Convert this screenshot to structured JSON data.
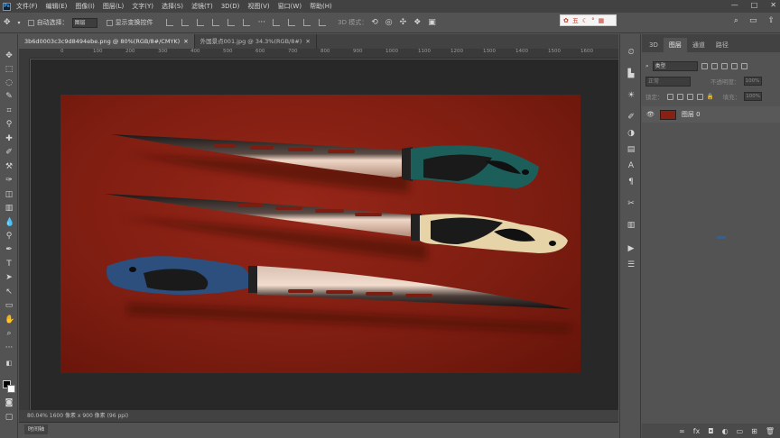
{
  "menubar": {
    "logo": "Ps",
    "items": [
      "文件(F)",
      "编辑(E)",
      "图像(I)",
      "图层(L)",
      "文字(Y)",
      "选择(S)",
      "滤镜(T)",
      "3D(D)",
      "视图(V)",
      "窗口(W)",
      "帮助(H)"
    ],
    "window_controls": [
      "—",
      "□",
      "✕"
    ]
  },
  "options": {
    "auto_select_label": "自动选择：",
    "auto_select_value": "图层",
    "transform_label": "显示变换控件",
    "mode_3d_label": "3D 模式：",
    "ime_text": "五"
  },
  "tabs": [
    {
      "label": "3b6d0003c3c9d8494ebe.png @ 80%(RGB/8#/CMYK)",
      "active": true
    },
    {
      "label": "外国景点001.jpg @ 34.3%(RGB/8#)",
      "active": false
    }
  ],
  "ruler": {
    "h_ticks": [
      "0",
      "100",
      "200",
      "300",
      "400",
      "500",
      "600",
      "700",
      "800",
      "900",
      "1000",
      "1100",
      "1200",
      "1300",
      "1400",
      "1500",
      "1600"
    ]
  },
  "status": {
    "text": "80.04%    1600 像素 x 900 像素 (96 ppi)"
  },
  "timeline": {
    "label": "时间轴"
  },
  "panel": {
    "tabs": [
      "3D",
      "图层",
      "通道",
      "路径"
    ],
    "active_tab": "图层",
    "filter_kind": "类型",
    "blend_mode": "正常",
    "opacity_label": "不透明度：",
    "opacity_value": "100%",
    "lock_label": "锁定：",
    "fill_label": "填充：",
    "fill_value": "100%",
    "layers": [
      {
        "name": "图层 0",
        "visible": true
      }
    ]
  },
  "colors": {
    "canvas_bg": "#8a2014",
    "ui_dark": "#424242",
    "ui_mid": "#535353",
    "workspace": "#282828",
    "knife1_handle": "#1c5f5a",
    "knife2_handle": "#e6d3a8",
    "knife3_handle": "#2c4f7d"
  }
}
